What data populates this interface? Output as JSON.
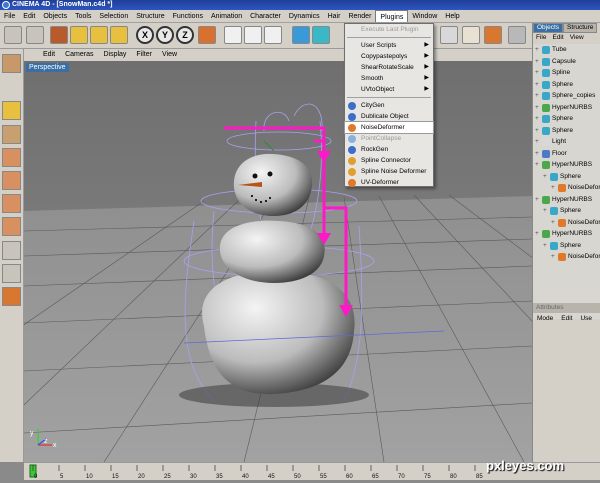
{
  "window": {
    "title": "CINEMA 4D - [SnowMan.c4d *]"
  },
  "menubar": [
    "File",
    "Edit",
    "Objects",
    "Tools",
    "Selection",
    "Structure",
    "Functions",
    "Animation",
    "Character",
    "Dynamics",
    "Hair",
    "Render",
    "Plugins",
    "Window",
    "Help"
  ],
  "menubar_active": "Plugins",
  "toolbar": {
    "axis_x": "X",
    "axis_y": "Y",
    "axis_z": "Z"
  },
  "viewport": {
    "menu": [
      "Edit",
      "Cameras",
      "Display",
      "Filter",
      "View"
    ],
    "label": "Perspective"
  },
  "plugins_menu": {
    "items": [
      {
        "label": "Execute Last Plugin",
        "disabled": true
      },
      {
        "label": "User Scripts",
        "submenu": true
      },
      {
        "label": "Copypastepolys",
        "submenu": true
      },
      {
        "label": "ShearRotateScale",
        "submenu": true
      },
      {
        "label": "Smooth",
        "submenu": true
      },
      {
        "label": "UVtoObject",
        "submenu": true
      },
      {
        "label": "CityGen",
        "icon_color": "#3a6ec8"
      },
      {
        "label": "Dublicate Object",
        "icon_color": "#3a6ec8"
      },
      {
        "label": "NoiseDeformer",
        "icon_color": "#e07a2a",
        "highlighted": true
      },
      {
        "label": "PointCollapse",
        "icon_color": "#8ab0e0",
        "disabled": true
      },
      {
        "label": "RockGen",
        "icon_color": "#3a6ec8"
      },
      {
        "label": "Spline Connector",
        "icon_color": "#e0a030"
      },
      {
        "label": "Spline Noise Deformer",
        "icon_color": "#e0a030"
      },
      {
        "label": "UV-Deformer",
        "icon_color": "#e07a2a"
      }
    ]
  },
  "right_panel": {
    "tabs": [
      "Objects",
      "Structure"
    ],
    "menu": [
      "File",
      "Edit",
      "View"
    ],
    "objects": [
      {
        "label": "Tube",
        "indent": 0,
        "icon_color": "#39a8c8"
      },
      {
        "label": "Capsule",
        "indent": 0,
        "icon_color": "#39a8c8"
      },
      {
        "label": "Spline",
        "indent": 0,
        "icon_color": "#39a8c8"
      },
      {
        "label": "Sphere",
        "indent": 0,
        "icon_color": "#39a8c8"
      },
      {
        "label": "Sphere_copies",
        "indent": 0,
        "icon_color": "#39a8c8"
      },
      {
        "label": "HyperNURBS",
        "indent": 0,
        "icon_color": "#4aa84a"
      },
      {
        "label": "Sphere",
        "indent": 0,
        "icon_color": "#39a8c8"
      },
      {
        "label": "Sphere",
        "indent": 0,
        "icon_color": "#39a8c8"
      },
      {
        "label": "Light",
        "indent": 0,
        "icon_color": "#d8d8d8"
      },
      {
        "label": "Floor",
        "indent": 0,
        "icon_color": "#4a7ac8"
      },
      {
        "label": "HyperNURBS",
        "indent": 0,
        "icon_color": "#4aa84a"
      },
      {
        "label": "Sphere",
        "indent": 1,
        "icon_color": "#39a8c8"
      },
      {
        "label": "NoiseDeformer",
        "indent": 2,
        "icon_color": "#e07a2a"
      },
      {
        "label": "HyperNURBS",
        "indent": 0,
        "icon_color": "#4aa84a"
      },
      {
        "label": "Sphere",
        "indent": 1,
        "icon_color": "#39a8c8"
      },
      {
        "label": "NoiseDeformer",
        "indent": 2,
        "icon_color": "#e07a2a"
      },
      {
        "label": "HyperNURBS",
        "indent": 0,
        "icon_color": "#4aa84a"
      },
      {
        "label": "Sphere",
        "indent": 1,
        "icon_color": "#39a8c8"
      },
      {
        "label": "NoiseDeformer",
        "indent": 2,
        "icon_color": "#e07a2a"
      }
    ],
    "attributes_label": "Attributes",
    "attr_menu": [
      "Mode",
      "Edit",
      "Use"
    ]
  },
  "timeline": {
    "ticks": [
      "0",
      "5",
      "10",
      "15",
      "20",
      "25",
      "30",
      "35",
      "40",
      "45",
      "50",
      "55",
      "60",
      "65",
      "70",
      "75",
      "80",
      "85"
    ]
  },
  "watermark": "pxleyes.com",
  "colors": {
    "arrow": "#ff18c8",
    "menu_highlight": "#ffffff",
    "titlebar": "#2547a8"
  }
}
